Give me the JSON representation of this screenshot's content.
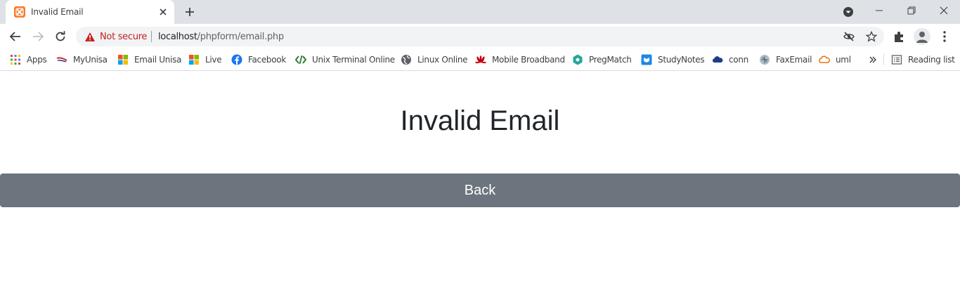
{
  "tab": {
    "title": "Invalid Email"
  },
  "toolbar": {
    "security_label": "Not secure",
    "url_host": "localhost",
    "url_path": "/phpform/email.php"
  },
  "bookmarks": {
    "items": [
      {
        "label": "Apps",
        "icon": "apps-grid-icon"
      },
      {
        "label": "MyUnisa",
        "icon": "myunisa-icon"
      },
      {
        "label": "Email Unisa",
        "icon": "microsoft-icon"
      },
      {
        "label": "Live",
        "icon": "microsoft-icon"
      },
      {
        "label": "Facebook",
        "icon": "facebook-icon"
      },
      {
        "label": "Unix Terminal Online",
        "icon": "code-icon"
      },
      {
        "label": "Linux Online",
        "icon": "globe-icon"
      },
      {
        "label": "Mobile Broadband",
        "icon": "huawei-icon"
      },
      {
        "label": "PregMatch",
        "icon": "pregmatch-icon"
      },
      {
        "label": "StudyNotes",
        "icon": "studynotes-icon"
      },
      {
        "label": "conn",
        "icon": "cloud-icon"
      },
      {
        "label": "FaxEmail",
        "icon": "faxemail-icon"
      },
      {
        "label": "uml",
        "icon": "uml-cloud-icon"
      }
    ],
    "reading_list_label": "Reading list"
  },
  "page": {
    "heading": "Invalid Email",
    "back_button_label": "Back"
  },
  "colors": {
    "button_bg": "#6c757d",
    "warning_red": "#c5221f",
    "tabstrip_bg": "#dee1e6"
  }
}
